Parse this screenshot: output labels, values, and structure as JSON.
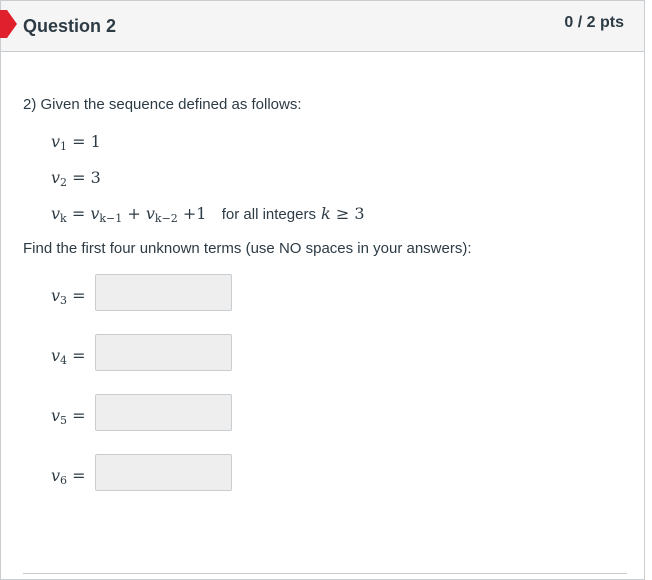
{
  "header": {
    "title": "Question 2",
    "points": "0 / 2 pts",
    "flag_color": "#e0202c"
  },
  "question": {
    "prompt": "2) Given the sequence defined as follows:",
    "definitions": [
      {
        "var": "v",
        "sub": "1",
        "expr": "= 1"
      },
      {
        "var": "v",
        "sub": "2",
        "expr": "= 3"
      }
    ],
    "recurrence": {
      "lhs_var": "v",
      "lhs_sub": "k",
      "eq": "=",
      "t1_var": "v",
      "t1_sub": "k−1",
      "plus1": "+",
      "t2_var": "v",
      "t2_sub": "k−2",
      "plus2": "+",
      "const": "1",
      "condition_text": "for all integers",
      "cond_var": "k",
      "cond_op": "≥",
      "cond_val": "3"
    },
    "instruction": "Find the first four unknown terms (use NO spaces in your answers):"
  },
  "answers": [
    {
      "var": "v",
      "sub": "3",
      "eq": "=",
      "value": ""
    },
    {
      "var": "v",
      "sub": "4",
      "eq": "=",
      "value": ""
    },
    {
      "var": "v",
      "sub": "5",
      "eq": "=",
      "value": ""
    },
    {
      "var": "v",
      "sub": "6",
      "eq": "=",
      "value": ""
    }
  ]
}
